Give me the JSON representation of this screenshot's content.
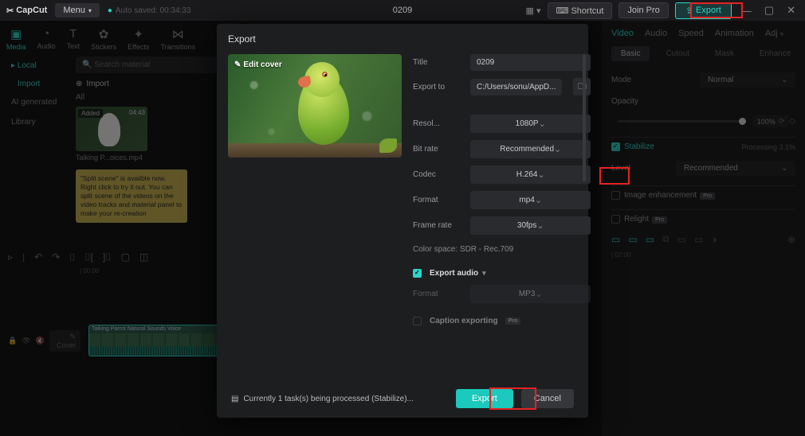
{
  "app": {
    "name": "CapCut",
    "menu_label": "Menu",
    "autosave": "Auto saved: 00:34:33",
    "project_title": "0209"
  },
  "titlebar_right": {
    "shortcut": "Shortcut",
    "join_pro": "Join Pro",
    "export": "Export"
  },
  "tools": [
    {
      "icon": "▣",
      "label": "Media",
      "active": true
    },
    {
      "icon": "◔",
      "label": "Audio"
    },
    {
      "icon": "T",
      "label": "Text"
    },
    {
      "icon": "✿",
      "label": "Stickers"
    },
    {
      "icon": "✦",
      "label": "Effects"
    },
    {
      "icon": "⋈",
      "label": "Transitions"
    }
  ],
  "sidebar": {
    "items": [
      "Local",
      "AI generated",
      "Library"
    ],
    "sub": "Import"
  },
  "media": {
    "search_placeholder": "Search material",
    "import": "Import",
    "all": "All",
    "thumb_tag": "Added",
    "thumb_duration": "04:43",
    "thumb_name": "Talking P...oices.mp4",
    "tip": "\"Split scene\" is availble now. Right click to try it out. You can split scene of the videos on the video tracks and material panel to make your re-creation"
  },
  "inspector": {
    "tabs": [
      "Video",
      "Audio",
      "Speed",
      "Animation",
      "Adj"
    ],
    "subtabs": [
      "Basic",
      "Cutout",
      "Mask",
      "Enhance"
    ],
    "mode_label": "Mode",
    "mode_value": "Normal",
    "opacity_label": "Opacity",
    "opacity_value": "100%",
    "stabilize_label": "Stabilize",
    "stabilize_status": "Processing 3.1%",
    "level_label": "Level",
    "level_value": "Recommended",
    "enhance_label": "Image enhancement",
    "relight_label": "Relight",
    "timeline_marker": "| 00:00",
    "timeline_marker2": "| 02:00"
  },
  "timeline": {
    "ruler0": "00:00",
    "cover_label": "Cover",
    "clip_title": "Talking Parrot Natural Sounds Voice",
    "clip_width": 188
  },
  "modal": {
    "title": "Export",
    "cover_edit": "Edit cover",
    "rows": {
      "title_label": "Title",
      "title_value": "0209",
      "exportto_label": "Export to",
      "exportto_value": "C:/Users/sonu/AppD...",
      "res_label": "Resol...",
      "res_value": "1080P",
      "bitrate_label": "Bit rate",
      "bitrate_value": "Recommended",
      "codec_label": "Codec",
      "codec_value": "H.264",
      "format_label": "Format",
      "format_value": "mp4",
      "fps_label": "Frame rate",
      "fps_value": "30fps",
      "colorspace": "Color space: SDR - Rec.709",
      "export_audio": "Export audio",
      "audio_format_label": "Format",
      "audio_format_value": "MP3",
      "caption_label": "Caption exporting"
    },
    "status": "Currently 1 task(s) being processed (Stabilize)...",
    "export_btn": "Export",
    "cancel_btn": "Cancel"
  }
}
